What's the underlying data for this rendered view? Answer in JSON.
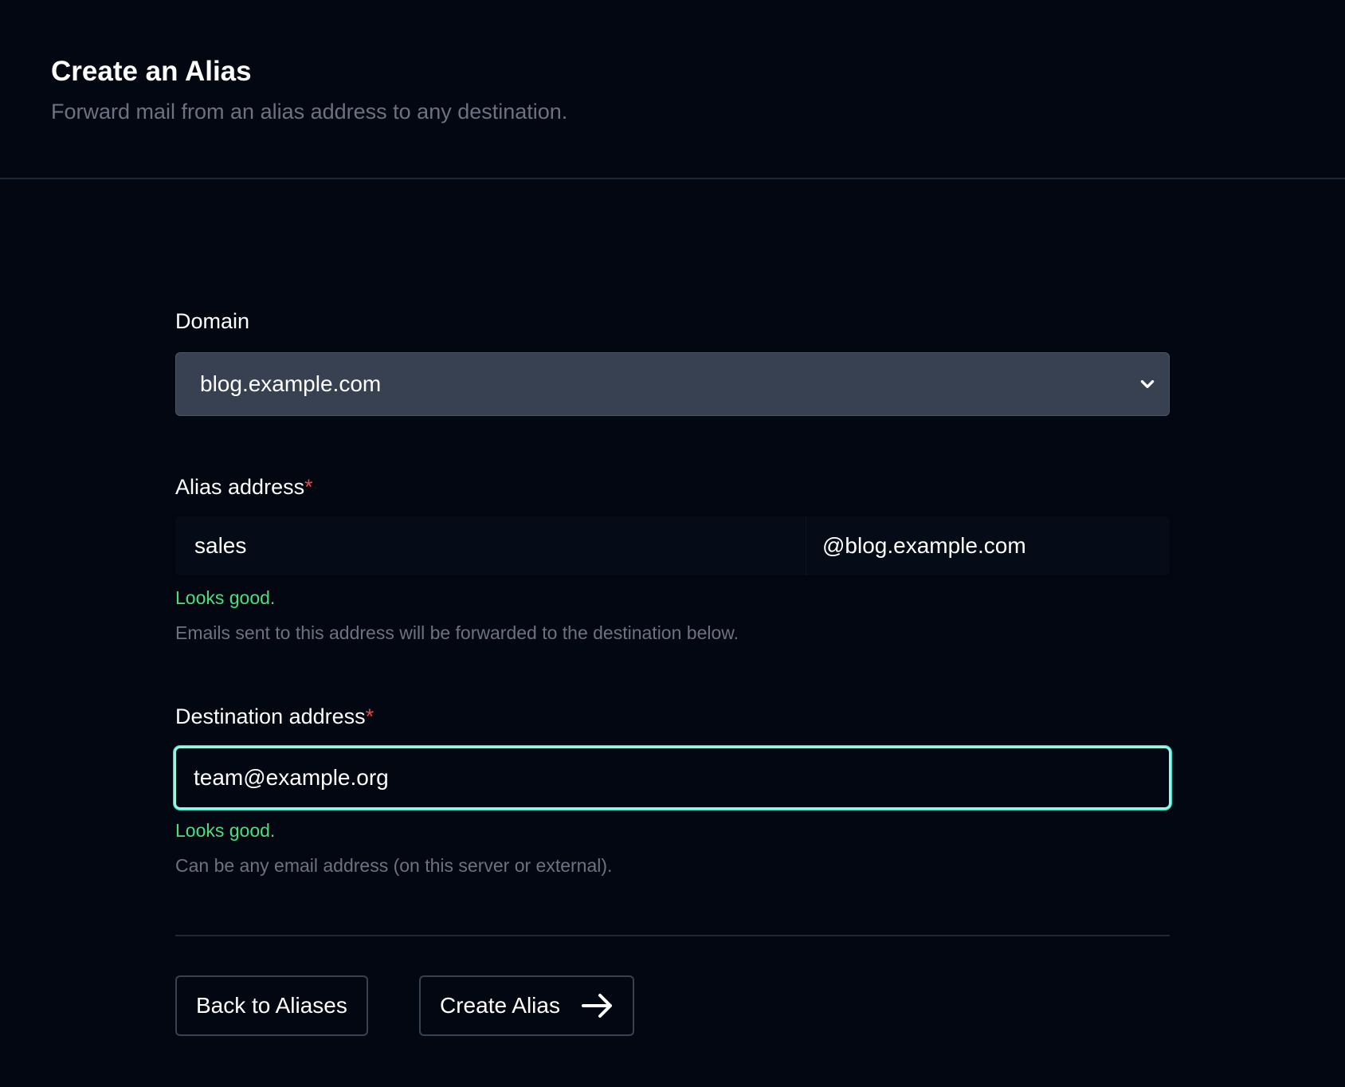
{
  "header": {
    "title": "Create an Alias",
    "subtitle": "Forward mail from an alias address to any destination."
  },
  "form": {
    "domain": {
      "label": "Domain",
      "selected": "blog.example.com",
      "icon": "chevron-down-icon"
    },
    "alias": {
      "label": "Alias address",
      "required_mark": "*",
      "value": "sales",
      "suffix": "@blog.example.com",
      "valid_message": "Looks good.",
      "help": "Emails sent to this address will be forwarded to the destination below."
    },
    "destination": {
      "label": "Destination address",
      "required_mark": "*",
      "value": "team@example.org",
      "valid_message": "Looks good.",
      "help": "Can be any email address (on this server or external)."
    }
  },
  "actions": {
    "back_label": "Back to Aliases",
    "create_label": "Create Alias",
    "create_icon": "arrow-right-icon"
  },
  "colors": {
    "background": "#030712",
    "select_bg": "#374151",
    "success": "#4ade80",
    "required": "#ef4444",
    "focus_ring": "#99f6e4",
    "muted_text": "#6b7280"
  }
}
